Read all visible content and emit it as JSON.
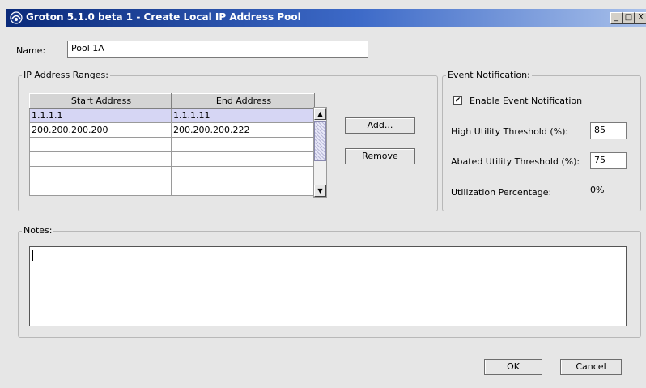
{
  "window": {
    "title": "Groton 5.1.0 beta 1 - Create Local IP Address Pool",
    "controls": {
      "minimize": "_",
      "maximize": "□",
      "close": "X"
    }
  },
  "name": {
    "label": "Name:",
    "value": "Pool 1A"
  },
  "ranges": {
    "legend": "IP Address Ranges:",
    "columns": [
      "Start Address",
      "End Address"
    ],
    "rows": [
      [
        "1.1.1.1",
        "1.1.1.11"
      ],
      [
        "200.200.200.200",
        "200.200.200.222"
      ],
      [
        "",
        ""
      ],
      [
        "",
        ""
      ],
      [
        "",
        ""
      ],
      [
        "",
        ""
      ]
    ],
    "add_label": "Add...",
    "remove_label": "Remove"
  },
  "event": {
    "legend": "Event Notification:",
    "enable_label": "Enable Event Notification",
    "enable_checked": true,
    "high_label": "High Utility Threshold (%):",
    "high_value": "85",
    "abated_label": "Abated Utility Threshold (%):",
    "abated_value": "75",
    "util_label": "Utilization Percentage:",
    "util_value": "0%"
  },
  "notes": {
    "legend": "Notes:",
    "value": ""
  },
  "footer": {
    "ok_label": "OK",
    "cancel_label": "Cancel"
  },
  "colors": {
    "selected_row": "#d6d6f4",
    "title_gradient_start": "#0a2a7a"
  }
}
